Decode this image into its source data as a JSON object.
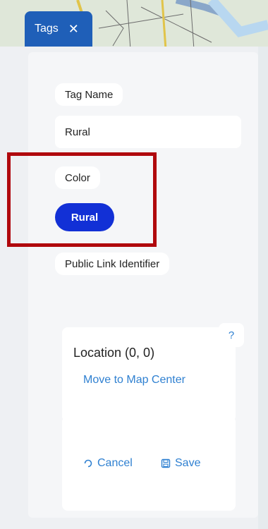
{
  "tab": {
    "label": "Tags",
    "close_icon": "close-icon"
  },
  "form": {
    "tag_name_label": "Tag Name",
    "tag_name_value": "Rural",
    "color_label": "Color",
    "color_value": "Rural",
    "color_hex": "#1230d6",
    "public_link_label": "Public Link Identifier"
  },
  "location": {
    "title": "Location (0, 0)",
    "move_link": "Move to Map Center",
    "help": "?"
  },
  "actions": {
    "cancel": "Cancel",
    "save": "Save",
    "cancel_icon": "refresh-icon",
    "save_icon": "save-icon"
  },
  "colors": {
    "tab_bg": "#1f5fb8",
    "link": "#2f80d1",
    "highlight": "#b0080d"
  }
}
